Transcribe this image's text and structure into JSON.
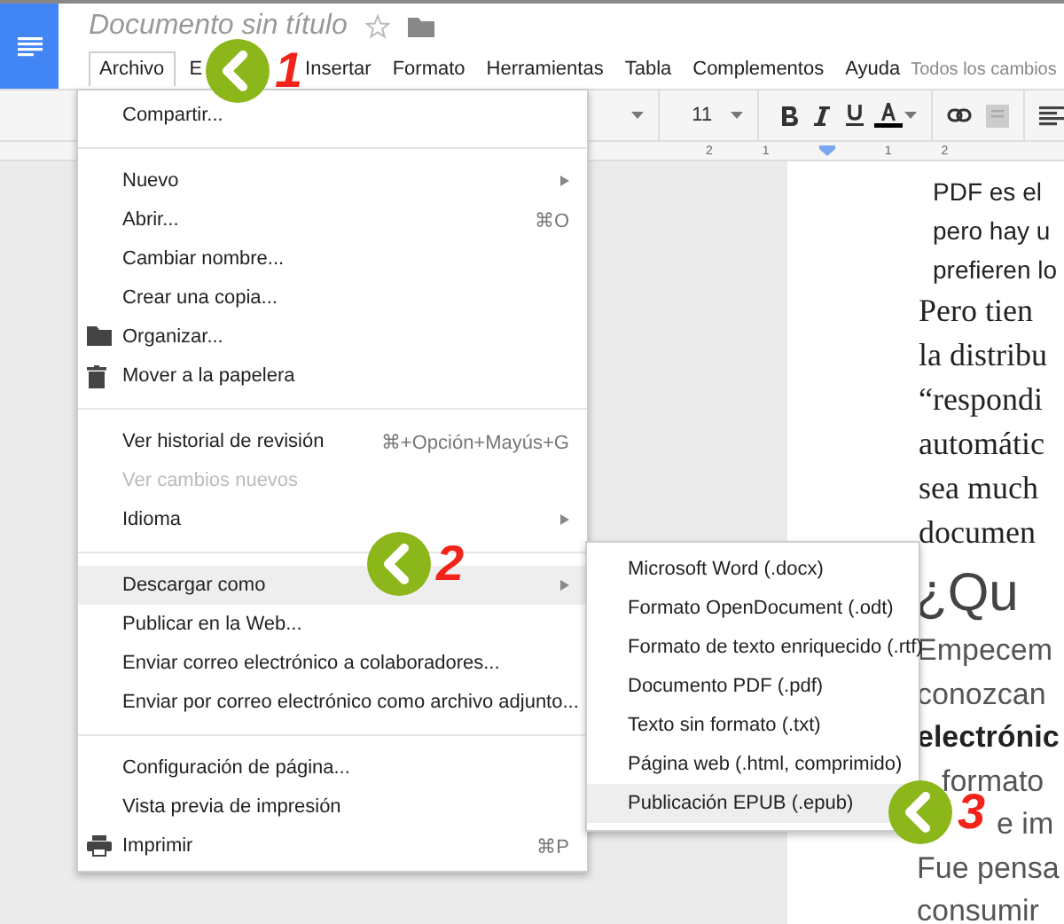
{
  "document_title": "Documento sin título",
  "menubar": [
    {
      "label": "Archivo",
      "selected": true
    },
    {
      "label": "E",
      "selected": false
    },
    {
      "label": "Insertar",
      "selected": false
    },
    {
      "label": "Formato",
      "selected": false
    },
    {
      "label": "Herramientas",
      "selected": false
    },
    {
      "label": "Tabla",
      "selected": false
    },
    {
      "label": "Complementos",
      "selected": false
    },
    {
      "label": "Ayuda",
      "selected": false
    }
  ],
  "save_status": "Todos los cambios",
  "toolbar": {
    "font_size": "11"
  },
  "ruler_labels": [
    "2",
    "1",
    "1",
    "2"
  ],
  "document": {
    "lines": [
      {
        "kind": "sans",
        "text": "PDF es el"
      },
      {
        "kind": "sans",
        "text": "pero hay u"
      },
      {
        "kind": "sans",
        "text": "prefieren lo"
      },
      {
        "kind": "serif",
        "text": "Pero tien"
      },
      {
        "kind": "serif",
        "text": "la distribu"
      },
      {
        "kind": "serif",
        "text": "“respondi"
      },
      {
        "kind": "serif",
        "text": "automátic"
      },
      {
        "kind": "serif",
        "text": "sea much"
      },
      {
        "kind": "serif",
        "text": "documen"
      },
      {
        "kind": "heading",
        "text": "¿Qu"
      },
      {
        "kind": "body",
        "text": "Empecem"
      },
      {
        "kind": "body",
        "text": "conozcan"
      },
      {
        "kind": "bold",
        "text": "electrónic"
      },
      {
        "kind": "body_cut",
        "text": "formato"
      },
      {
        "kind": "body_cut2",
        "text": "e im"
      },
      {
        "kind": "body",
        "text": "Fue pensa"
      },
      {
        "kind": "body",
        "text": "consumir"
      }
    ]
  },
  "file_menu": {
    "items": [
      {
        "kind": "item",
        "label": "Compartir...",
        "disabled": false,
        "selected": false
      },
      {
        "kind": "separator"
      },
      {
        "kind": "item",
        "label": "Nuevo",
        "submenu": true,
        "disabled": false,
        "selected": false
      },
      {
        "kind": "item",
        "label": "Abrir...",
        "shortcut": "⌘O",
        "disabled": false,
        "selected": false
      },
      {
        "kind": "item",
        "label": "Cambiar nombre...",
        "disabled": false,
        "selected": false
      },
      {
        "kind": "item",
        "label": "Crear una copia...",
        "disabled": false,
        "selected": false
      },
      {
        "kind": "folder_item",
        "label": "Organizar...",
        "disabled": false,
        "selected": false
      },
      {
        "kind": "trash_item",
        "label": "Mover a la papelera",
        "disabled": false,
        "selected": false
      },
      {
        "kind": "separator"
      },
      {
        "kind": "item",
        "label": "Ver historial de revisión",
        "shortcut": "⌘+Opción+Mayús+G",
        "disabled": false,
        "selected": false
      },
      {
        "kind": "item",
        "label": "Ver cambios nuevos",
        "disabled": true,
        "selected": false
      },
      {
        "kind": "item",
        "label": "Idioma",
        "submenu": true,
        "disabled": false,
        "selected": false
      },
      {
        "kind": "separator"
      },
      {
        "kind": "item",
        "label": "Descargar como",
        "submenu": true,
        "disabled": false,
        "selected": true
      },
      {
        "kind": "item",
        "label": "Publicar en la Web...",
        "disabled": false,
        "selected": false
      },
      {
        "kind": "item",
        "label": "Enviar correo electrónico a colaboradores...",
        "disabled": false,
        "selected": false
      },
      {
        "kind": "item",
        "label": "Enviar por correo electrónico como archivo adjunto...",
        "disabled": false,
        "selected": false
      },
      {
        "kind": "separator"
      },
      {
        "kind": "item",
        "label": "Configuración de página...",
        "disabled": false,
        "selected": false
      },
      {
        "kind": "item",
        "label": "Vista previa de impresión",
        "disabled": false,
        "selected": false
      },
      {
        "kind": "printer_item",
        "label": "Imprimir",
        "shortcut": "⌘P",
        "disabled": false,
        "selected": false
      }
    ]
  },
  "download_submenu": {
    "items": [
      {
        "label": "Microsoft Word (.docx)",
        "selected": false
      },
      {
        "label": "Formato OpenDocument (.odt)",
        "selected": false
      },
      {
        "label": "Formato de texto enriquecido (.rtf)",
        "selected": false
      },
      {
        "label": "Documento PDF (.pdf)",
        "selected": false
      },
      {
        "label": "Texto sin formato (.txt)",
        "selected": false
      },
      {
        "label": "Página web (.html, comprimido)",
        "selected": false
      },
      {
        "label": "Publicación EPUB (.epub)",
        "selected": true
      }
    ]
  },
  "callouts": [
    {
      "number": "1"
    },
    {
      "number": "2"
    },
    {
      "number": "3"
    }
  ]
}
